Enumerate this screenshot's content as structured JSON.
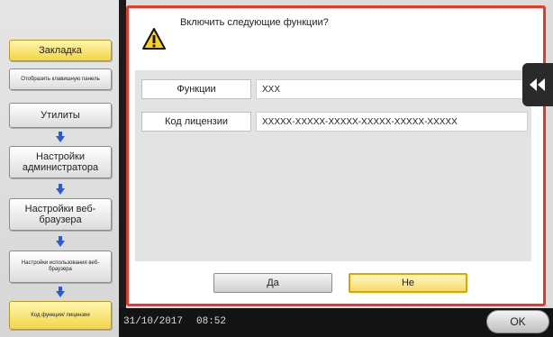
{
  "sidebar": {
    "bookmark": "Закладка",
    "show_keypad": "Отобразить клавишную панель",
    "utilities": "Утилиты",
    "admin_settings": "Настройки администратора",
    "browser_settings": "Настройки веб-браузера",
    "browser_usage_settings": "Настройки использования веб-браузера",
    "function_code": "Код функции/ лицензии"
  },
  "dialog": {
    "message": "Включить следующие функции?",
    "function_label": "Функции",
    "function_value": "XXX",
    "license_label": "Код лицензии",
    "license_value": "XXXXX-XXXXX-XXXXX-XXXXX-XXXXX-XXXXX",
    "yes_label": "Да",
    "no_label": "Не"
  },
  "status": {
    "date": "31/10/2017",
    "time": "08:52",
    "ok_label": "OK"
  },
  "colors": {
    "dialog_border": "#e53a2a",
    "highlight_yellow": "#f2d548"
  }
}
